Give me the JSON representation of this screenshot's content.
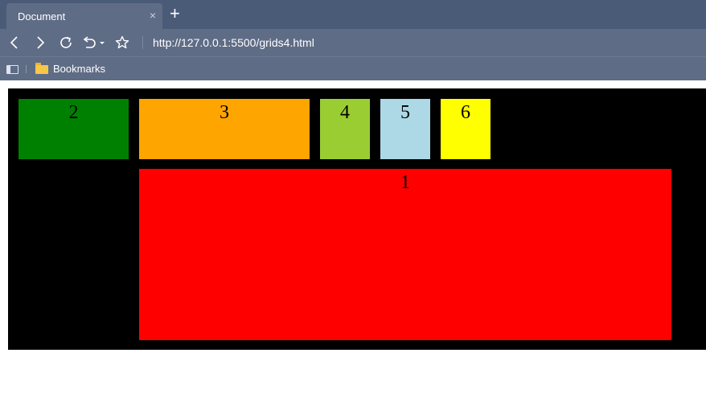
{
  "browser": {
    "tab_title": "Document",
    "tab_close": "×",
    "new_tab": "+",
    "url": "http://127.0.0.1:5500/grids4.html",
    "bookmarks_label": "Bookmarks",
    "icons": [
      "back-icon",
      "forward-icon",
      "reload-icon",
      "undo-icon",
      "star-icon",
      "sidebar-icon",
      "folder-icon"
    ]
  },
  "grid": {
    "background": "#000000",
    "items": [
      {
        "label": "1",
        "color": "#ff0000"
      },
      {
        "label": "2",
        "color": "#008000"
      },
      {
        "label": "3",
        "color": "#ffa500"
      },
      {
        "label": "4",
        "color": "#9acd32"
      },
      {
        "label": "5",
        "color": "#add8e6"
      },
      {
        "label": "6",
        "color": "#ffff00"
      }
    ]
  }
}
